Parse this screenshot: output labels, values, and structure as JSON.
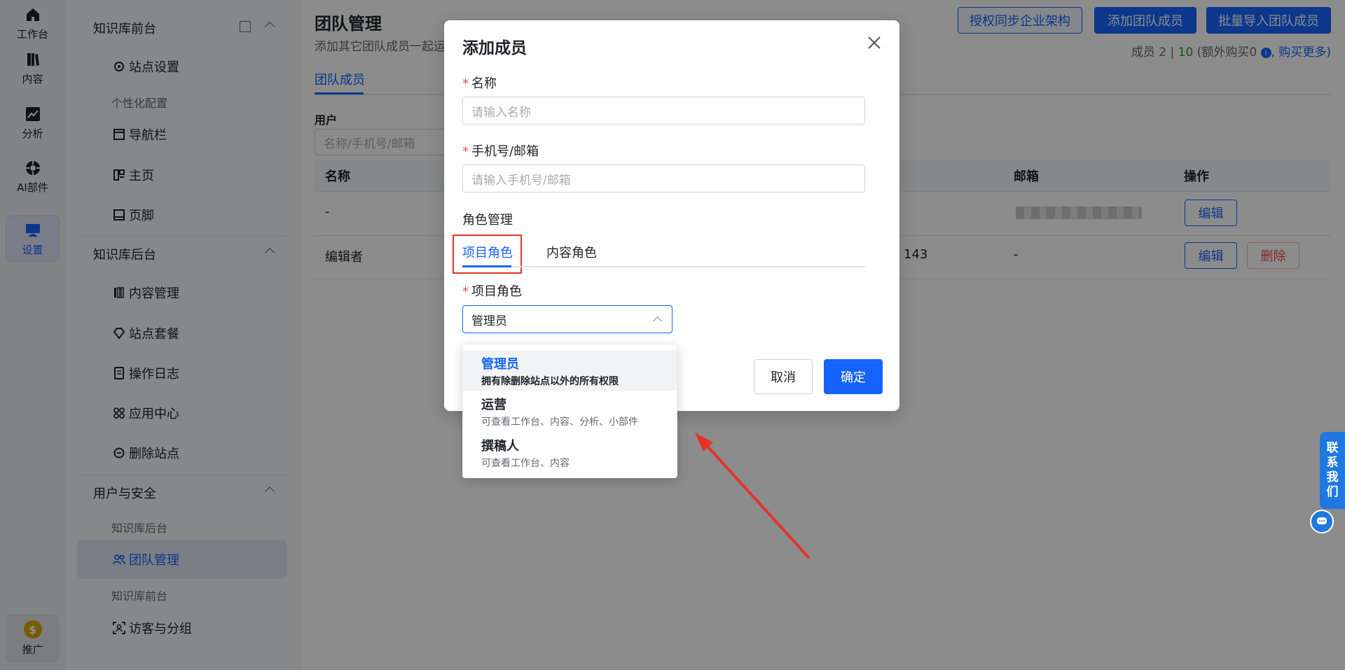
{
  "rail": {
    "items": [
      {
        "label": "工作台",
        "icon": "home-icon"
      },
      {
        "label": "内容",
        "icon": "book-icon"
      },
      {
        "label": "分析",
        "icon": "chart-line-icon"
      },
      {
        "label": "AI部件",
        "icon": "ai-widget-icon"
      },
      {
        "label": "设置",
        "icon": "monitor-icon",
        "active": true
      }
    ],
    "bottom": {
      "label": "推广",
      "coin": "$"
    }
  },
  "sidebar": {
    "group1": "知识库前台",
    "site_settings": "站点设置",
    "personalize": "个性化配置",
    "navbar": "导航栏",
    "home": "主页",
    "footer": "页脚",
    "group2": "知识库后台",
    "content_mgmt": "内容管理",
    "site_package": "站点套餐",
    "op_log": "操作日志",
    "app_center": "应用中心",
    "delete_site": "删除站点",
    "group3": "用户与安全",
    "kb_backend": "知识库后台",
    "team_mgmt": "团队管理",
    "kb_frontend": "知识库前台",
    "visitors": "访客与分组"
  },
  "main": {
    "title": "团队管理",
    "subtitle": "添加其它团队成员一起运",
    "btn_sync": "授权同步企业架构",
    "btn_add": "添加团队成员",
    "btn_import": "批量导入团队成员",
    "count_prefix": "成员 2 | ",
    "count_limit": "10",
    "count_extra": " (额外购买0 ",
    "count_buy": ", 购买更多)",
    "tab": "团队成员",
    "filter_label": "用户",
    "filter_placeholder": "名称/手机号/邮箱",
    "columns": {
      "name": "名称",
      "email": "邮箱",
      "actions": "操作"
    },
    "rows": [
      {
        "name": "-",
        "phone": "",
        "email": "",
        "edit": "编辑"
      },
      {
        "name": "编辑者",
        "phone": "143",
        "email": "-",
        "edit": "编辑",
        "delete": "删除"
      }
    ]
  },
  "contact": {
    "text": [
      "联",
      "系",
      "我",
      "们"
    ]
  },
  "modal": {
    "title": "添加成员",
    "name_label": "名称",
    "name_placeholder": "请输入名称",
    "phone_label": "手机号/邮箱",
    "phone_placeholder": "请输入手机号/邮箱",
    "role_mgmt": "角色管理",
    "tab_project": "项目角色",
    "tab_content": "内容角色",
    "project_role_label": "项目角色",
    "project_role_value": "管理员",
    "cancel": "取消",
    "ok": "确定"
  },
  "dropdown": {
    "options": [
      {
        "title": "管理员",
        "desc": "拥有除删除站点以外的所有权限",
        "selected": true
      },
      {
        "title": "运营",
        "desc": "可查看工作台、内容、分析、小部件"
      },
      {
        "title": "撰稿人",
        "desc": "可查看工作台、内容"
      }
    ]
  },
  "colors": {
    "accent": "#1664ff",
    "highlight": "#e5332a"
  }
}
